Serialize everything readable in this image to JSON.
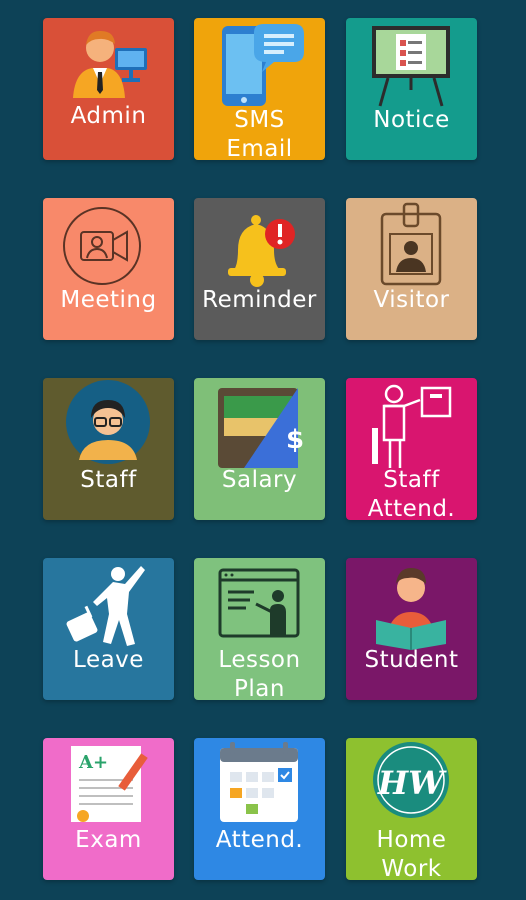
{
  "tiles": [
    {
      "key": "admin",
      "label": "Admin",
      "color": "#d95038",
      "icon": "admin-person-icon"
    },
    {
      "key": "sms-email",
      "label": "SMS\nEmail",
      "color": "#f0a40b",
      "icon": "phone-chat-icon"
    },
    {
      "key": "notice",
      "label": "Notice",
      "color": "#149c8d",
      "icon": "notice-board-icon"
    },
    {
      "key": "meeting",
      "label": "Meeting",
      "color": "#f8896a",
      "icon": "video-call-icon"
    },
    {
      "key": "reminder",
      "label": "Reminder",
      "color": "#5b5b5b",
      "icon": "bell-alert-icon"
    },
    {
      "key": "visitor",
      "label": "Visitor",
      "color": "#dbb186",
      "icon": "id-badge-icon"
    },
    {
      "key": "staff",
      "label": "Staff",
      "color": "#5f5b2e",
      "icon": "staff-avatar-icon"
    },
    {
      "key": "salary",
      "label": "Salary",
      "color": "#7fbf78",
      "icon": "wallet-dollar-icon"
    },
    {
      "key": "staff-attend",
      "label": "Staff\nAttend.",
      "color": "#d9156f",
      "icon": "teacher-board-icon"
    },
    {
      "key": "leave",
      "label": "Leave",
      "color": "#27769e",
      "icon": "traveler-luggage-icon"
    },
    {
      "key": "lesson-plan",
      "label": "Lesson\nPlan",
      "color": "#7fc27e",
      "icon": "presentation-screen-icon"
    },
    {
      "key": "student",
      "label": "Student",
      "color": "#7a1768",
      "icon": "student-reading-icon"
    },
    {
      "key": "exam",
      "label": "Exam",
      "color": "#f06cc9",
      "icon": "exam-paper-icon"
    },
    {
      "key": "attend",
      "label": "Attend.",
      "color": "#2e88e4",
      "icon": "calendar-check-icon"
    },
    {
      "key": "home-work",
      "label": "Home\nWork",
      "color": "#8ec12f",
      "icon": "homework-badge-icon"
    }
  ]
}
